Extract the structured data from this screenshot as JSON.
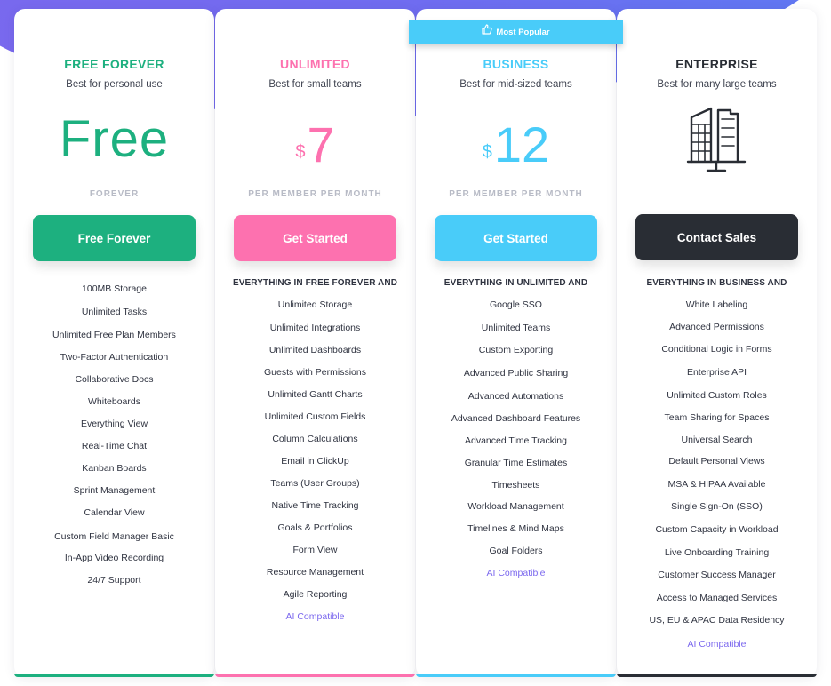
{
  "badge": {
    "label": "Most Popular",
    "icon": "thumbs-up-icon"
  },
  "colors": {
    "free": "#1db07f",
    "unlimited": "#fd71af",
    "business": "#49ccf9",
    "enterprise": "#292d34",
    "ai": "#7b68ee",
    "muted": "#b8bbc6"
  },
  "plans": [
    {
      "name": "FREE FOREVER",
      "subtitle": "Best for personal use",
      "price": "Free",
      "price_label": "FOREVER",
      "cta": "Free Forever",
      "features": [
        "100MB Storage",
        "Unlimited Tasks",
        "Unlimited Free Plan Members",
        "Two-Factor Authentication",
        "Collaborative Docs",
        "Whiteboards",
        "Everything View",
        "Real-Time Chat",
        "Kanban Boards",
        "Sprint Management",
        "Calendar View",
        "Custom Field Manager Basic",
        "In-App Video Recording",
        "24/7 Support"
      ]
    },
    {
      "name": "UNLIMITED",
      "subtitle": "Best for small teams",
      "currency": "$",
      "price": "7",
      "price_label": "PER MEMBER PER MONTH",
      "cta": "Get Started",
      "heading": "EVERYTHING IN FREE FOREVER AND",
      "features": [
        "Unlimited Storage",
        "Unlimited Integrations",
        "Unlimited Dashboards",
        "Guests with Permissions",
        "Unlimited Gantt Charts",
        "Unlimited Custom Fields",
        "Column Calculations",
        "Email in ClickUp",
        "Teams (User Groups)",
        "Native Time Tracking",
        "Goals & Portfolios",
        "Form View",
        "Resource Management",
        "Agile Reporting"
      ],
      "ai": "AI Compatible"
    },
    {
      "name": "BUSINESS",
      "subtitle": "Best for mid-sized teams",
      "currency": "$",
      "price": "12",
      "price_label": "PER MEMBER PER MONTH",
      "cta": "Get Started",
      "heading": "EVERYTHING IN UNLIMITED AND",
      "features": [
        "Google SSO",
        "Unlimited Teams",
        "Custom Exporting",
        "Advanced Public Sharing",
        "Advanced Automations",
        "Advanced Dashboard Features",
        "Advanced Time Tracking",
        "Granular Time Estimates",
        "Timesheets",
        "Workload Management",
        "Timelines & Mind Maps",
        "Goal Folders"
      ],
      "ai": "AI Compatible"
    },
    {
      "name": "ENTERPRISE",
      "subtitle": "Best for many large teams",
      "icon": "enterprise-buildings-icon",
      "cta": "Contact Sales",
      "heading": "EVERYTHING IN BUSINESS AND",
      "features": [
        "White Labeling",
        "Advanced Permissions",
        "Conditional Logic in Forms",
        "Enterprise API",
        "Unlimited Custom Roles",
        "Team Sharing for Spaces",
        "Universal Search",
        "Default Personal Views",
        "MSA & HIPAA Available",
        "Single Sign-On (SSO)",
        "Custom Capacity in Workload",
        "Live Onboarding Training",
        "Customer Success Manager",
        "Access to Managed Services",
        "US, EU & APAC Data Residency"
      ],
      "ai": "AI Compatible"
    }
  ]
}
